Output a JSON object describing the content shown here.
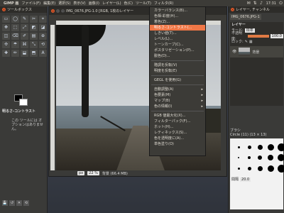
{
  "topbar": {
    "app_name": "GIMP 画",
    "menus": [
      "ファイル(F)",
      "編集(E)",
      "選択(S)",
      "表示(V)",
      "画像(I)",
      "レイヤー(L)",
      "色(C)",
      "ツール(T)",
      "フィルタ(R)"
    ],
    "clock": "17:31"
  },
  "toolbox": {
    "title": "ツールボックス",
    "tool_icons": [
      "▭",
      "◯",
      "✎",
      "✂",
      "⌖",
      "✥",
      "⬚",
      "⤢",
      "◩",
      "◪",
      "◫",
      "⌫",
      "✐",
      "▤",
      "⊕",
      "✣",
      "☂",
      "⌘",
      "⤡",
      "⟲",
      "✚",
      "✏",
      "⬓",
      "⬒",
      "A"
    ],
    "options_header": "明るさ-コントラスト",
    "options_note": "この ツールには オプションはありません。",
    "bottom_icons": [
      "💾",
      "↺",
      "✕",
      "⟲"
    ]
  },
  "imgwin": {
    "title": "IMG_0676.JPG-1.0 [RGB, 1枚のレイヤー",
    "unit": "px",
    "zoom": "22 %",
    "status": "背景 (66.4 MB)"
  },
  "menu": {
    "items": [
      {
        "label": "カラーバランス(B)...",
        "state": "normal",
        "arrow": false
      },
      {
        "label": "色相-彩度(H)...",
        "state": "normal",
        "arrow": false
      },
      {
        "label": "着色(Z)...",
        "state": "normal",
        "arrow": false
      },
      {
        "label": "明るさ-コントラスト(...",
        "state": "active",
        "arrow": false
      },
      {
        "label": "しきい値(T)...",
        "state": "normal",
        "arrow": false
      },
      {
        "label": "レベル(L)...",
        "state": "normal",
        "arrow": false
      },
      {
        "label": "トーンカーブ(C)...",
        "state": "normal",
        "arrow": false
      },
      {
        "label": "ポスタリゼーション(P)...",
        "state": "normal",
        "arrow": false
      },
      {
        "label": "脱色(D)...",
        "state": "normal",
        "arrow": false
      },
      {
        "sep": true
      },
      {
        "label": "階調を反転(V)",
        "state": "normal",
        "arrow": false
      },
      {
        "label": "明度を反転(E)",
        "state": "normal",
        "arrow": false
      },
      {
        "sep": true
      },
      {
        "label": "GEGL を使用(G)",
        "state": "normal",
        "arrow": false
      },
      {
        "sep": true
      },
      {
        "label": "自動調整(A)",
        "state": "normal",
        "arrow": true
      },
      {
        "label": "色要素(M)",
        "state": "normal",
        "arrow": true
      },
      {
        "label": "マップ(B)",
        "state": "normal",
        "arrow": true
      },
      {
        "label": "色の情報(I)",
        "state": "normal",
        "arrow": true
      },
      {
        "sep": true
      },
      {
        "label": "RGB 値最大化(X)...",
        "state": "normal",
        "arrow": false
      },
      {
        "label": "フィルターパック(F)...",
        "state": "normal",
        "arrow": false
      },
      {
        "label": "ホット(H)...",
        "state": "normal",
        "arrow": false
      },
      {
        "label": "レティネックス(S)...",
        "state": "normal",
        "arrow": false
      },
      {
        "label": "色を透明度に(A)...",
        "state": "normal",
        "arrow": false
      },
      {
        "label": "単色塗り(O)",
        "state": "normal",
        "arrow": false
      }
    ]
  },
  "dock": {
    "title": "レイヤー, チャンネル",
    "image_tab": "IMG_0676.JPG-1",
    "layers_header": "レイヤー",
    "mode_label": "モード:",
    "mode_value": "標準",
    "opacity_label": "不透明度:",
    "opacity_value": "100.0",
    "lock_label": "ロック:",
    "layer_name": "背景",
    "brush_header": "ブラシ",
    "brush_name": "Circle (11) (13 × 13)",
    "brush_spacing_label": "間隔",
    "brush_spacing_value": "20.0",
    "brush_sizes": [
      3,
      5,
      7,
      9,
      11,
      2,
      4,
      6,
      8,
      10,
      3,
      5,
      7,
      9,
      11
    ]
  }
}
